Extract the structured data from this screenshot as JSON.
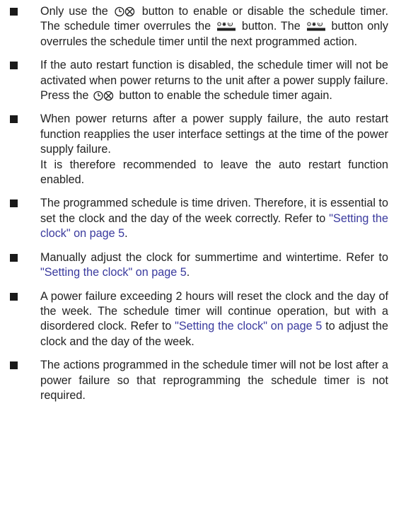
{
  "bullets": [
    {
      "p1_before": "Only use the",
      "p1_mid1": "button to enable or disable the schedule timer. The schedule timer overrules the",
      "p1_mid2": "button. The",
      "p1_after": "button only overrules the schedule timer until the next programmed action.",
      "icons": [
        "schedule-timer-button-icon",
        "operation-mode-button-icon"
      ]
    },
    {
      "text_before": "If the auto restart function is disabled, the schedule timer will not be activated when power returns to the unit after a power supply failure. Press the",
      "text_after": "button to enable the schedule timer again.",
      "icons": [
        "schedule-timer-button-icon"
      ]
    },
    {
      "para1": "When power returns after a power supply failure, the auto restart function reapplies the user interface settings at the time of the power supply failure.",
      "para2": "It is therefore recommended to leave the auto restart function enabled."
    },
    {
      "text_before": "The programmed schedule is time driven. Therefore, it is essential to set the clock and the day of the week correctly. Refer to",
      "link": "\"Setting the clock\" on page 5",
      "text_after": "."
    },
    {
      "text_before": "Manually adjust the clock for summertime and wintertime. Refer to",
      "link": "\"Setting the clock\" on page 5",
      "text_after": "."
    },
    {
      "text_before": "A power failure exceeding 2 hours will reset the clock and the day of the week. The schedule timer will continue operation, but with a disordered clock. Refer to",
      "link": "\"Setting the clock\" on page 5",
      "text_after": "to adjust the clock and the day of the week."
    },
    {
      "text": "The actions programmed in the schedule timer will not be lost after a power failure so that reprogramming the schedule timer is not required."
    }
  ],
  "colors": {
    "text": "#222222",
    "link": "#3a3a9e",
    "bullet": "#1a1a1a"
  }
}
